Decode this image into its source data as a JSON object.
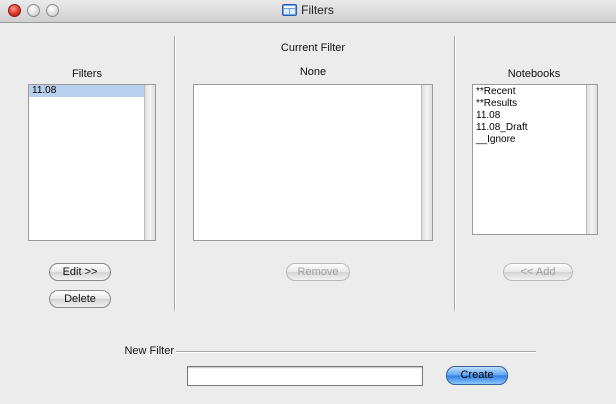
{
  "window": {
    "title": "Filters"
  },
  "filters_panel": {
    "heading": "Filters",
    "items": [
      {
        "label": "11.08",
        "selected": true
      }
    ],
    "edit_button": "Edit >>",
    "delete_button": "Delete"
  },
  "current_filter_panel": {
    "heading": "Current Filter",
    "value": "None",
    "items": [],
    "remove_button": "Remove"
  },
  "notebooks_panel": {
    "heading": "Notebooks",
    "items": [
      {
        "label": "**Recent"
      },
      {
        "label": "**Results"
      },
      {
        "label": "11.08"
      },
      {
        "label": "11.08_Draft"
      },
      {
        "label": "__Ignore"
      }
    ],
    "add_button": "<< Add"
  },
  "new_filter": {
    "label": "New Filter",
    "value": "",
    "create_button": "Create"
  },
  "colors": {
    "selection": "#b8cfee",
    "close_button": "#d43222",
    "primary_button": "#5aa3f0"
  }
}
